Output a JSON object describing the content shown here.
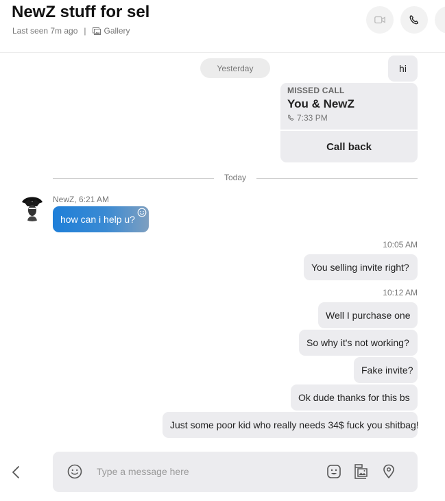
{
  "header": {
    "title": "NewZ stuff for sel",
    "last_seen": "Last seen 7m ago",
    "separator": "|",
    "gallery_label": "Gallery",
    "icons": [
      "video-call-icon",
      "phone-icon",
      "profile-icon"
    ]
  },
  "chat": {
    "date_yesterday": "Yesterday",
    "msg_hi": "hi",
    "missed_call": {
      "label": "MISSED CALL",
      "participants": "You & NewZ",
      "time": "7:33 PM",
      "action": "Call back"
    },
    "date_today": "Today",
    "incoming": {
      "sender_line": "NewZ, 6:21 AM",
      "text": "how can i help u?"
    },
    "ts_1": "10:05 AM",
    "msg_1": "You selling invite right?",
    "ts_2": "10:12 AM",
    "msg_2": "Well I purchase one",
    "msg_3": "So why it's not working?",
    "msg_4": "Fake invite?",
    "msg_5": "Ok dude thanks for this bs",
    "msg_6": "Just some poor kid who really needs 34$ fuck you shitbag!"
  },
  "composer": {
    "placeholder": "Type a message here",
    "icons": [
      "emoji-icon",
      "sticker-icon",
      "media-icon",
      "location-icon"
    ]
  },
  "colors": {
    "accent_blue": "#1f7fd8",
    "bubble_gray": "#ececef"
  }
}
